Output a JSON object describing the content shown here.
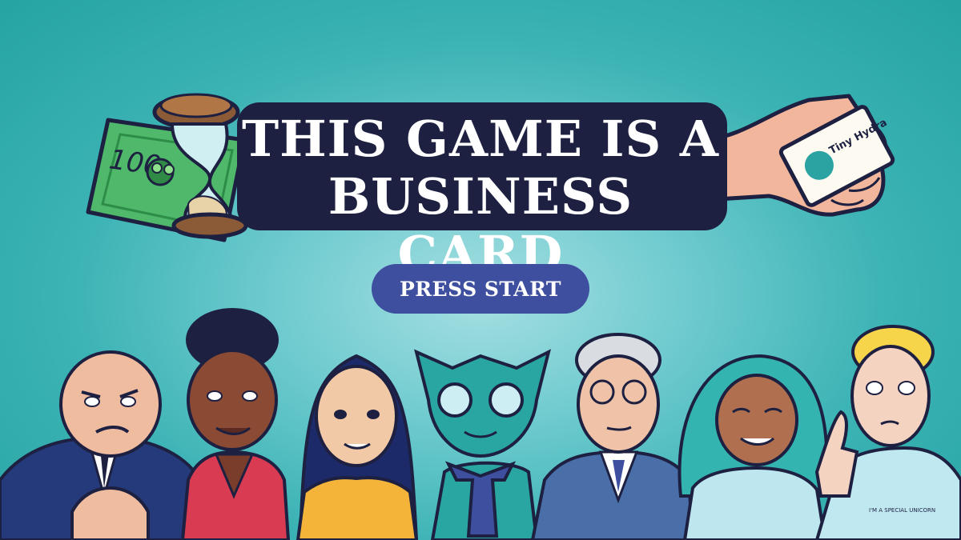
{
  "title": {
    "line1": "THIS GAME IS A",
    "line2": "BUSINESS CARD"
  },
  "start_button": {
    "label": "PRESS START"
  },
  "props": {
    "banknote_value": "100",
    "card_brand": "Tiny Hydra"
  },
  "characters": [
    {
      "id": "bald-businessman",
      "shirt_text": ""
    },
    {
      "id": "woman-red-blazer",
      "shirt_text": ""
    },
    {
      "id": "woman-yellow-top",
      "shirt_text": ""
    },
    {
      "id": "teal-dragon",
      "shirt_text": ""
    },
    {
      "id": "grey-haired-man",
      "shirt_text": ""
    },
    {
      "id": "woman-teal-hair",
      "shirt_text": ""
    },
    {
      "id": "blond-person-unicorn-shirt",
      "shirt_text": "I'M A SPECIAL UNICORN"
    }
  ],
  "colors": {
    "background": "#3cb3b5",
    "title_outline": "#1d2040",
    "button": "#3f4fa0",
    "text": "#ffffff"
  }
}
